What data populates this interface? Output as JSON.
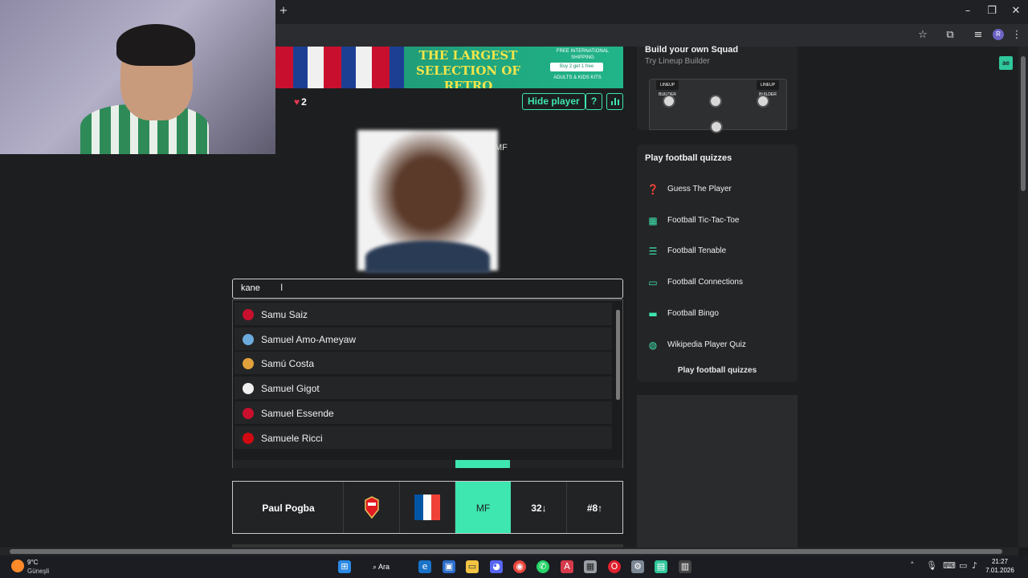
{
  "browser": {
    "new_tab": "+",
    "minimize": "–",
    "maximize": "❐",
    "close": "✕",
    "profile_initial": "R"
  },
  "banner": {
    "title": "THE LARGEST SELECTION OF RETRO FOOTBALL SHIRTS IN THE WORLD",
    "shipping": "FREE INTERNATIONAL SHIPPING",
    "offer": "Buy 2 get 1 free",
    "kits": "ADULTS & KIDS KITS"
  },
  "game": {
    "lives_count": "2",
    "hide_player_label": "Hide player",
    "help_label": "?",
    "stats_icon": "bar-chart-icon",
    "position_hint": "MF"
  },
  "search": {
    "value": "kane"
  },
  "suggestions": [
    {
      "name": "Samu Saiz",
      "crest_color": "#c8102e"
    },
    {
      "name": "Samuel Amo-Ameyaw",
      "crest_color": "#6cabdd"
    },
    {
      "name": "Samú Costa",
      "crest_color": "#e2a23b"
    },
    {
      "name": "Samuel Gigot",
      "crest_color": "#f0f0f0"
    },
    {
      "name": "Samuel Essende",
      "crest_color": "#c8102e"
    },
    {
      "name": "Samuele Ricci",
      "crest_color": "#d10a11"
    }
  ],
  "guess": {
    "name": "Paul Pogba",
    "position": "MF",
    "age": "32↓",
    "shirt": "#8↑",
    "club_color": "#e11b22",
    "nation_colors": [
      "#0055a4",
      "#ffffff",
      "#ef4135"
    ]
  },
  "sidebar": {
    "lineup_title": "Build your own Squad",
    "lineup_subtitle": "Try Lineup Builder",
    "lineup_badge": "LINEUP BUILDER",
    "quiz_title": "Play football quizzes",
    "quizzes": [
      {
        "label": "Guess The Player",
        "icon": "question-icon"
      },
      {
        "label": "Football Tic-Tac-Toe",
        "icon": "grid-icon"
      },
      {
        "label": "Football Tenable",
        "icon": "list-icon"
      },
      {
        "label": "Football Connections",
        "icon": "connections-icon"
      },
      {
        "label": "Football Bingo",
        "icon": "bingo-icon"
      },
      {
        "label": "Wikipedia Player Quiz",
        "icon": "globe-icon"
      }
    ],
    "quiz_footer": "Play football quizzes"
  },
  "taskbar": {
    "temperature": "9°C",
    "weather": "Güneşli",
    "search": "Ara",
    "time": "21:27",
    "date": "7.01.2026"
  },
  "colors": {
    "accent": "#3ee6b0",
    "heart": "#e53950"
  }
}
